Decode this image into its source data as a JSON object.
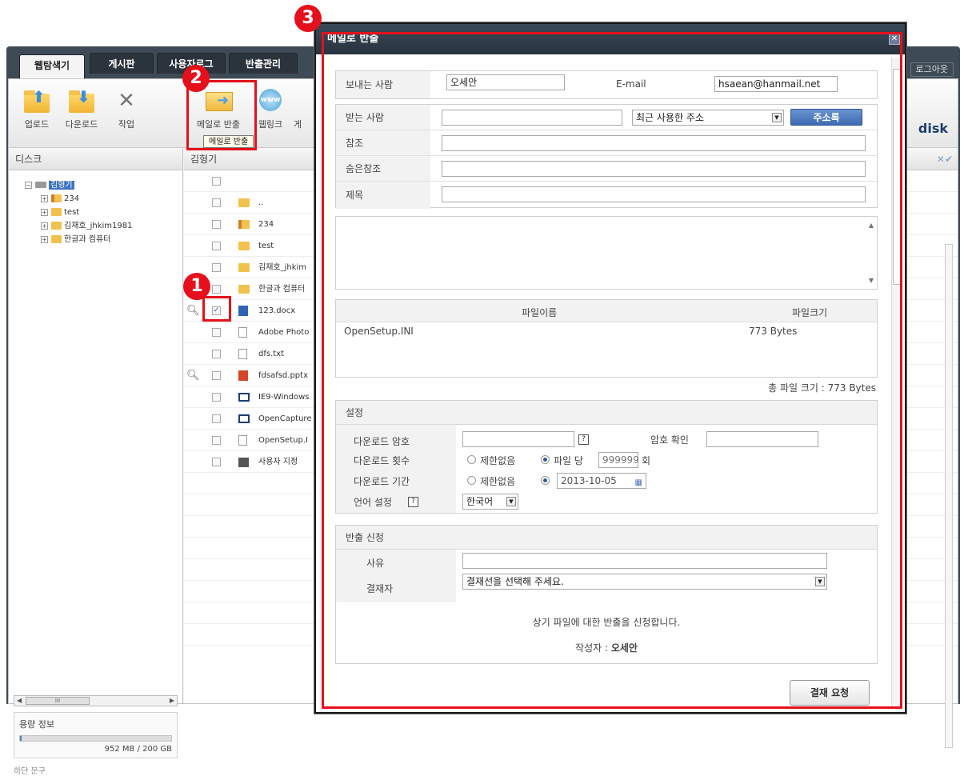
{
  "tabs": [
    "웹탐색기",
    "게시판",
    "사용자로그",
    "반출관리"
  ],
  "logout_label": "로그아웃",
  "toolbar": {
    "upload": "업로드",
    "download": "다운로드",
    "work": "작업",
    "mail_export": "메일로 반출",
    "weblink": "웹링크",
    "more": "게",
    "tooltip": "메일로 반출"
  },
  "brand": "disk",
  "disk_panel": {
    "title": "디스크",
    "root": "김형기",
    "children": [
      "234",
      "test",
      "김재호_jhkim1981",
      "한글과 컴퓨터"
    ],
    "scroll_thumb": "III",
    "capacity_label": "용량 정보",
    "capacity_fraction": 0.005,
    "capacity_value": "952 MB / 200 GB",
    "footer": "하단 문구"
  },
  "file_panel": {
    "title": "김형기",
    "rows": [
      {
        "name": "..",
        "type": "folder"
      },
      {
        "name": "234",
        "type": "user"
      },
      {
        "name": "test",
        "type": "folder"
      },
      {
        "name": "김재호_jhkim",
        "type": "folder"
      },
      {
        "name": "한글과 컴퓨터",
        "type": "folder"
      },
      {
        "name": "123.docx",
        "type": "word",
        "checked": true,
        "preview": true
      },
      {
        "name": "Adobe Photo",
        "type": "doc"
      },
      {
        "name": "dfs.txt",
        "type": "doc"
      },
      {
        "name": "fdsafsd.pptx",
        "type": "ppt",
        "preview": true
      },
      {
        "name": "IE9-Windows",
        "type": "win"
      },
      {
        "name": "OpenCapture",
        "type": "win"
      },
      {
        "name": "OpenSetup.I",
        "type": "doc"
      },
      {
        "name": "사용자 지정",
        "type": "exe"
      }
    ]
  },
  "dialog": {
    "title": "메일로 반출",
    "sender_label": "보내는 사람",
    "sender_value": "오세안",
    "email_label": "E-mail",
    "email_value": "hsaean@hanmail.net",
    "to_label": "받는 사람",
    "recent_label": "최근 사용한 주소",
    "address_book": "주소록",
    "cc_label": "참조",
    "bcc_label": "숨은참조",
    "subject_label": "제목",
    "files_col_name": "파일이름",
    "files_col_size": "파일크기",
    "files": [
      {
        "name": "OpenSetup.INI",
        "size": "773 Bytes"
      }
    ],
    "total_size": "총 파일 크기 : 773 Bytes",
    "settings_title": "설정",
    "dl_password": "다운로드 암호",
    "password_confirm": "암호 확인",
    "dl_count": "다운로드 횟수",
    "unlimited": "제한없음",
    "per_file": "파일 당",
    "count_value": "999999",
    "times": "회",
    "dl_period": "다운로드 기간",
    "date_value": "2013-10-05",
    "language_label": "언어 설정",
    "language_value": "한국어",
    "request_title": "반출 신청",
    "reason_label": "사유",
    "approver_label": "결재자",
    "approver_placeholder": "결재선을 선택해 주세요.",
    "notice": "상기 파일에 대한 반출을 신청합니다.",
    "author_label": "작성자 :",
    "author_value": "오세안",
    "submit": "결재 요청"
  },
  "badges": [
    "1",
    "2",
    "3"
  ],
  "colors": {
    "highlight": "#e5101b",
    "header": "#3e4a56",
    "accent": "#3d6ab1"
  }
}
